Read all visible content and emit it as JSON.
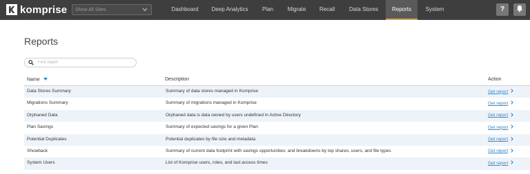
{
  "app": {
    "logo_text": "komprise",
    "site_select": {
      "value": "Show All Sites"
    }
  },
  "nav": {
    "items": [
      {
        "label": "Dashboard",
        "active": false
      },
      {
        "label": "Deep Analytics",
        "active": false
      },
      {
        "label": "Plan",
        "active": false
      },
      {
        "label": "Migrate",
        "active": false
      },
      {
        "label": "Recall",
        "active": false
      },
      {
        "label": "Data Stores",
        "active": false
      },
      {
        "label": "Reports",
        "active": true
      },
      {
        "label": "System",
        "active": false
      }
    ],
    "help_label": "?",
    "icons": {
      "help": "question-icon",
      "notifications": "bell-icon"
    }
  },
  "page": {
    "title": "Reports",
    "search": {
      "placeholder": "Find report",
      "value": ""
    }
  },
  "table": {
    "columns": {
      "name": "Name",
      "description": "Description",
      "action": "Action"
    },
    "sort": {
      "column": "name",
      "direction": "descending"
    },
    "rows": [
      {
        "name": "Data Stores Summary",
        "description": "Summary of data stores managed in Komprise",
        "action": "Get report"
      },
      {
        "name": "Migrations Summary",
        "description": "Summary of migrations managed in Komprise",
        "action": "Get report"
      },
      {
        "name": "Orphaned Data",
        "description": "Orphaned data is data owned by users undefined in Active Directory",
        "action": "Get report"
      },
      {
        "name": "Plan Savings",
        "description": "Summary of expected savings for a given Plan",
        "action": "Get report"
      },
      {
        "name": "Potential Duplicates",
        "description": "Potential duplicates by file size and metadata",
        "action": "Get report"
      },
      {
        "name": "Showback",
        "description": "Summary of current data footprint with savings opportunities; and breakdowns by top shares, users, and file types",
        "action": "Get report"
      },
      {
        "name": "System Users",
        "description": "List of Komprise users, roles, and last access times",
        "action": "Get report"
      }
    ]
  },
  "colors": {
    "topbar": "#3e3e3e",
    "active_tab_underline": "#e0a22a",
    "link": "#2f86c9",
    "row_shade": "#eef3fa"
  }
}
